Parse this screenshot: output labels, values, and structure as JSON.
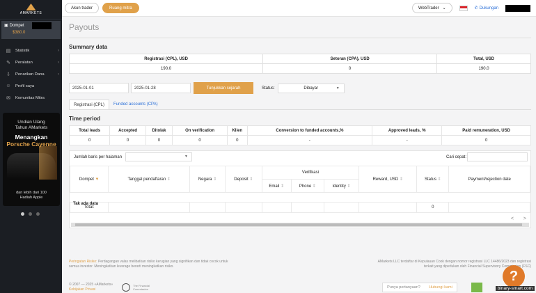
{
  "sidebar": {
    "logo": "AMARKETS",
    "wallet": {
      "label": "Dompet",
      "amount": "$380.0"
    },
    "items": [
      {
        "label": "Statistik",
        "icon": "chart-icon",
        "chevron": true
      },
      {
        "label": "Peralatan",
        "icon": "tools-icon",
        "chevron": true
      },
      {
        "label": "Penarikan Dana",
        "icon": "withdraw-icon",
        "chevron": true
      },
      {
        "label": "Profil saya",
        "icon": "user-icon",
        "chevron": false
      },
      {
        "label": "Komunitas Mitra",
        "icon": "community-icon",
        "chevron": false
      }
    ],
    "ad": {
      "line1": "Undian Ulang",
      "line2": "Tahun AMarkets",
      "line3": "Menangkan",
      "line4": "Porsche Cayenne",
      "line5": "dan lebih dari 100",
      "line6": "Hadiah Apple"
    }
  },
  "topbar": {
    "tab_trader": "Akun trader",
    "tab_partner": "Ruang mitra",
    "webtrader": "WebTrader",
    "support": "Dukungan"
  },
  "page": {
    "title": "Payouts",
    "summary_title": "Summary data",
    "summary_headers": [
      "Registrasi (CPL), USD",
      "Setoran (CPA), USD",
      "Total, USD"
    ],
    "summary_values": [
      "190.0",
      "0",
      "190.0"
    ],
    "date_from": "2025-01-01",
    "date_to": "2025-01-28",
    "show_history": "Tunjukkan sejarah",
    "status_label": "Status:",
    "status_value": "Dibayar",
    "tabs": [
      "Registrasi (CPL)",
      "Funded accounts (CPA)"
    ],
    "time_period_title": "Time period",
    "tp_headers": [
      "Total leads",
      "Accepted",
      "Ditolak",
      "On verification",
      "Klien",
      "Conversion to funded accounts,%",
      "Approved leads, %",
      "Paid remuneration, USD"
    ],
    "tp_values": [
      "0",
      "0",
      "0",
      "0",
      "0",
      "-",
      "-",
      "0"
    ],
    "rows_per_page": "Jumlah baris per halaman",
    "quick_search": "Cari cepat:",
    "columns": {
      "wallet": "Dompet",
      "reg_date": "Tanggal pendaftaran",
      "country": "Negara",
      "deposit": "Deposit",
      "verification": "Verifikasi",
      "email": "Email",
      "phone": "Phone",
      "identity": "Identity",
      "reward": "Reward, USD",
      "status": "Status",
      "payment_date": "Payment/rejection date"
    },
    "no_data": "Tak ada data",
    "total_label": "Total:",
    "total_value": "0",
    "pager_prev": "<",
    "pager_next": ">"
  },
  "footer": {
    "risk_title": "Peringatan Risiko:",
    "risk_text": "Perdagangan valas melibatkan risiko kerugian yang signifikan dan tidak cocok untuk semua investor. Meningkatkan leverage berarti meningkatkan risiko.",
    "legal_text": "AMarkets LLC terdaftar di Kepulauan Cook dengan nomor registrasi LLC 14486/2023 dan registrasi terkait yang diperlukan oleh Financial Supervisory Commission (FSC)",
    "copyright": "© 2007 — 2025 «AMarkets»",
    "privacy": "Kebijakan Privasi",
    "fc_text": "The Financial Commission",
    "question": "Punya pertanyaan?",
    "contact": "Hubungi kami",
    "watermark": "binary-smart.com"
  },
  "colors": {
    "accent": "#e0a14a",
    "sidebar_bg": "#1b1e23",
    "link": "#2a6fd8"
  }
}
